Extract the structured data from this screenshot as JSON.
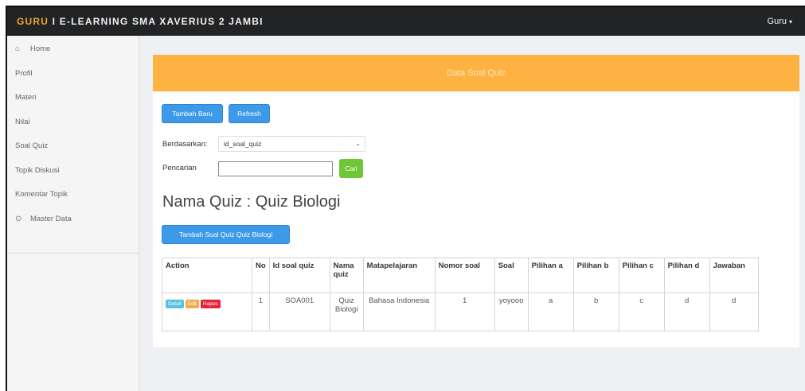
{
  "header": {
    "brand_accent": "GURU",
    "brand_rest": " I E-LEARNING SMA XAVERIUS 2 JAMBI",
    "user_label": "Guru",
    "caret_icon": "caret-down-icon"
  },
  "sidebar": {
    "items": [
      {
        "label": "Home",
        "icon": "home-icon"
      },
      {
        "label": "Profil"
      },
      {
        "label": "Materi"
      },
      {
        "label": "Nilai"
      },
      {
        "label": "Soal Quiz"
      },
      {
        "label": "Topik Diskusi"
      },
      {
        "label": "Komentar Topik"
      },
      {
        "label": "Master Data",
        "icon": "chevron-circle-icon"
      }
    ]
  },
  "panel": {
    "title": "Data Soal Quiz",
    "btn_add": "Tambah Baru",
    "btn_refresh": "Refresh",
    "filter_label": "Berdasarkan:",
    "filter_value": "id_soal_quiz",
    "search_label": "Pencarian",
    "search_value": "",
    "btn_search": "Cari",
    "quiz_title": "Nama Quiz : Quiz Biologi",
    "btn_add_question": "Tambah Soal Quiz Quiz Biologi"
  },
  "table": {
    "headers": [
      "Action",
      "No",
      "Id soal quiz",
      "Nama quiz",
      "Matapelajaran",
      "Nomor soal",
      "Soal",
      "Pilihan a",
      "Pilihan b",
      "Pilihan c",
      "Pilihan d",
      "Jawaban"
    ],
    "actions": {
      "detail": "Detail",
      "edit": "Edit",
      "hapus": "Hapus"
    },
    "rows": [
      {
        "no": "1",
        "id": "SOA001",
        "nama": "Quiz Biologi",
        "mapel": "Bahasa Indonesia",
        "nomor": "1",
        "soal": "yoyooo",
        "a": "a",
        "b": "b",
        "c": "c",
        "d": "d",
        "jawaban": "d"
      }
    ]
  },
  "colors": {
    "navbar": "#222325",
    "brand_accent": "#f0a52f",
    "panel_header": "#fdb241",
    "primary_button": "#3d9ae8",
    "success_button": "#6ec738",
    "danger_button": "#e7243b"
  }
}
